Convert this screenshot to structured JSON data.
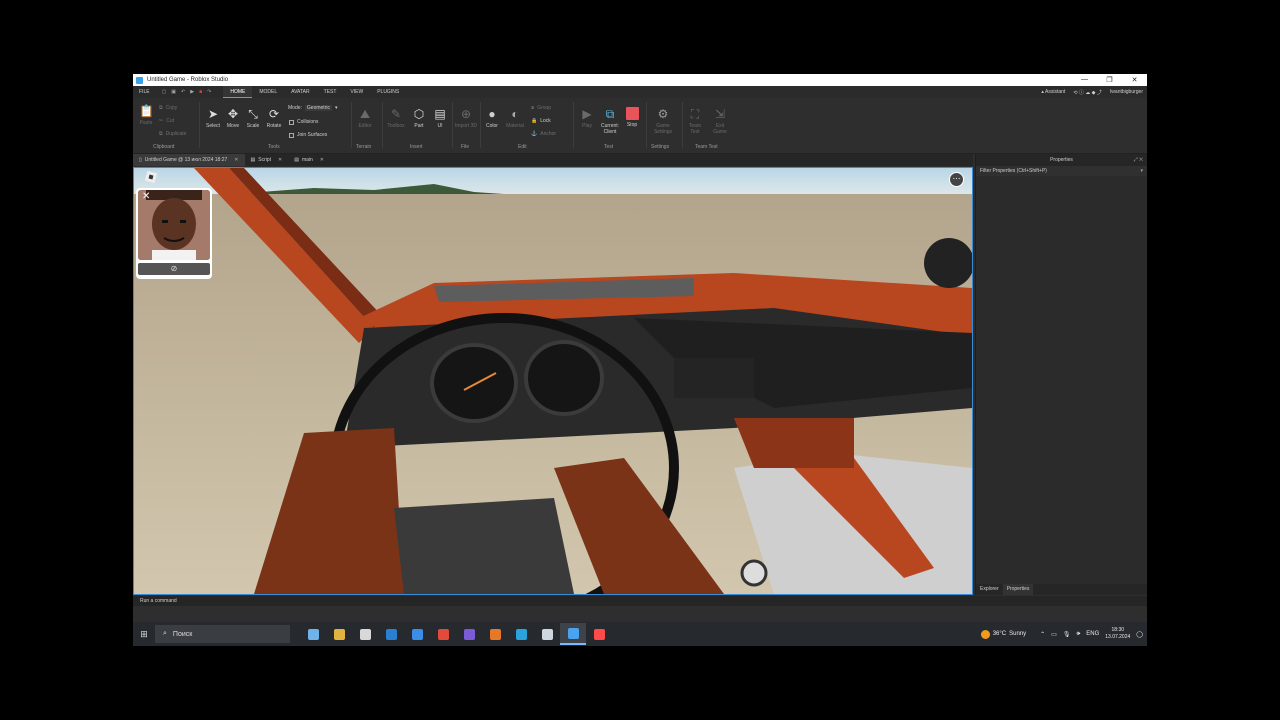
{
  "window": {
    "title": "Untitled Game - Roblox Studio",
    "controls": [
      "—",
      "❐",
      "✕"
    ]
  },
  "menubar": {
    "file": "FILE",
    "tabs": [
      "HOME",
      "MODEL",
      "AVATAR",
      "TEST",
      "VIEW",
      "PLUGINS"
    ],
    "assistant": "Assistant",
    "user": "Iwantbigburger"
  },
  "ribbon": {
    "clipboard": {
      "paste": "Paste",
      "copy": "Copy",
      "cut": "Cut",
      "duplicate": "Duplicate",
      "label": "Clipboard"
    },
    "tools": {
      "select": "Select",
      "move": "Move",
      "scale": "Scale",
      "rotate": "Rotate",
      "mode_label": "Mode:",
      "mode_value": "Geometric",
      "collisions": "Collisions",
      "join_surfaces": "Join Surfaces",
      "label": "Tools"
    },
    "terrain": {
      "editor": "Editor",
      "label": "Terrain"
    },
    "insert": {
      "toolbox": "Toolbox",
      "part": "Part",
      "ui": "UI",
      "label": "Insert"
    },
    "file": {
      "import3d": "Import 3D",
      "label": "File"
    },
    "edit": {
      "color": "Color",
      "material": "Material",
      "group": "Group",
      "lock": "Lock",
      "anchor": "Anchor",
      "label": "Edit"
    },
    "test": {
      "play": "Play",
      "current_client": "Current: Client",
      "stop": "Stop",
      "label": "Test"
    },
    "settings": {
      "game_settings": "Game Settings",
      "label": "Settings"
    },
    "team_test": {
      "team_test": "Team Test",
      "exit_game": "Exit Game",
      "label": "Team Test"
    }
  },
  "doctabs": [
    {
      "label": "Untitled Game @ 13 июл 2024 18:27",
      "active": true
    },
    {
      "label": "Script",
      "active": false
    },
    {
      "label": "main",
      "active": false
    }
  ],
  "viewport": {
    "menu_icon": "⋯",
    "cam_close": "✕",
    "cam_toggle": "⊘"
  },
  "properties_panel": {
    "title": "Properties",
    "filter_placeholder": "Filter Properties (Ctrl+Shift+P)",
    "bottom_tabs": [
      "Explorer",
      "Properties"
    ]
  },
  "command_bar": {
    "placeholder": "Run a command"
  },
  "taskbar": {
    "search_label": "Поиск",
    "weather_temp": "36°C",
    "weather_desc": "Sunny",
    "language": "ENG",
    "time": "18:30",
    "date": "13.07.2024",
    "app_colors": [
      "#6fb3e8",
      "#e3b341",
      "#d8d8d8",
      "#2b7fd1",
      "#3a8ee6",
      "#e24b3b",
      "#7b5bd6",
      "#e6782a",
      "#2aa3dd",
      "#cfd6de",
      "#4aa3f0",
      "#ff4a4a"
    ]
  },
  "colors": {
    "accent": "#3a8ad6",
    "stop_red": "#e8545a",
    "orange_body": "#b8461f"
  }
}
